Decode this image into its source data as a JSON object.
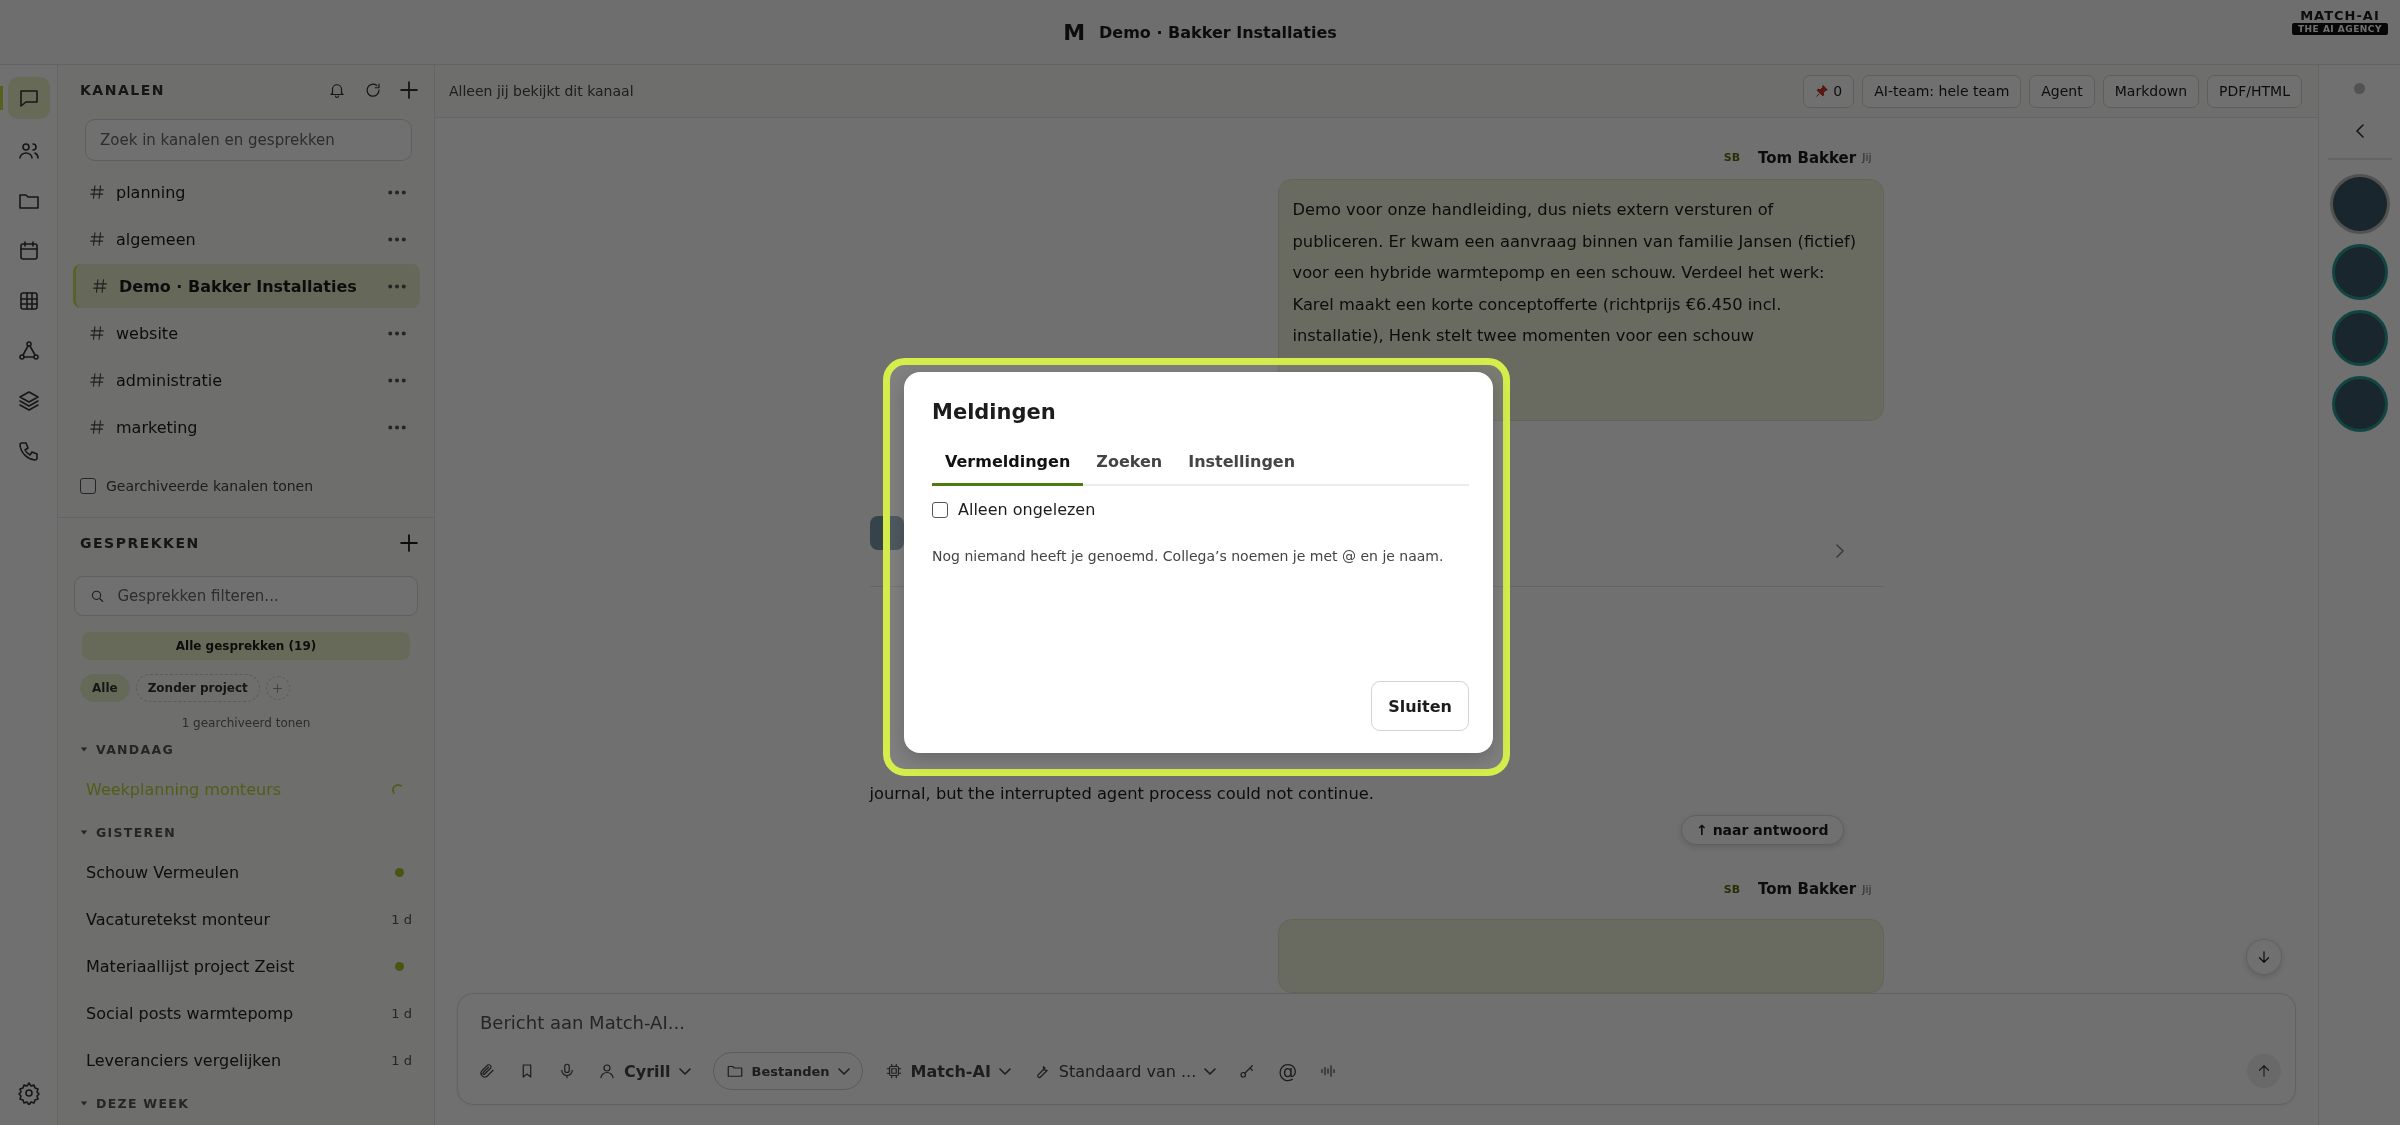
{
  "window": {
    "logo_letter": "M",
    "title": "Demo · Bakker Installaties",
    "brand": {
      "name": "MATCH-AI",
      "tagline": "THE AI AGENCY"
    }
  },
  "rail": {
    "items": [
      {
        "kind": "chat",
        "selected": true
      },
      {
        "kind": "people",
        "selected": false
      },
      {
        "kind": "folder",
        "selected": false
      },
      {
        "kind": "calendar",
        "selected": false
      },
      {
        "kind": "table",
        "selected": false
      },
      {
        "kind": "network",
        "selected": false
      },
      {
        "kind": "layers",
        "selected": false
      },
      {
        "kind": "phone",
        "selected": false
      }
    ]
  },
  "sidebar": {
    "channels_title": "KANALEN",
    "search": {
      "placeholder": "Zoek in kanalen en gesprekken"
    },
    "channels": [
      {
        "name": "planning",
        "selected": false
      },
      {
        "name": "algemeen",
        "selected": false
      },
      {
        "name": "Demo · Bakker Installaties",
        "selected": true
      },
      {
        "name": "website",
        "selected": false
      },
      {
        "name": "administratie",
        "selected": false
      },
      {
        "name": "marketing",
        "selected": false
      }
    ],
    "archived_toggle": {
      "label": "Gearchiveerde kanalen tonen",
      "checked": false
    },
    "conversations_title": "GESPREKKEN",
    "filter": {
      "placeholder": "Gesprekken filteren..."
    },
    "all_button": "Alle gesprekken (19)",
    "chips": [
      {
        "label": "Alle",
        "selected": true
      },
      {
        "label": "Zonder project",
        "selected": false
      }
    ],
    "archived_link": "1 gearchiveerd tonen",
    "groups": [
      {
        "title": "VANDAAG",
        "expanded": true,
        "items": [
          {
            "name": "Weekplanning monteurs",
            "selected": true,
            "kind": "spinner"
          }
        ]
      },
      {
        "title": "GISTEREN",
        "expanded": true,
        "items": [
          {
            "name": "Schouw Vermeulen",
            "selected": false,
            "kind": "dot"
          },
          {
            "name": "Vacaturetekst monteur",
            "selected": false,
            "kind": "age",
            "age": "1 d"
          },
          {
            "name": "Materiaallijst project Zeist",
            "selected": false,
            "kind": "dot"
          },
          {
            "name": "Social posts warmtepomp",
            "selected": false,
            "kind": "age",
            "age": "1 d"
          },
          {
            "name": "Leveranciers vergelijken",
            "selected": false,
            "kind": "age",
            "age": "1 d"
          }
        ]
      },
      {
        "title": "DEZE WEEK",
        "expanded": true
      }
    ]
  },
  "channel_bar": {
    "notice": "Alleen jij bekijkt dit kanaal",
    "pins": "0",
    "buttons": [
      "AI-team: hele team",
      "Agent",
      "Markdown",
      "PDF/HTML"
    ]
  },
  "messages": [
    {
      "kind": "user",
      "initials": "SB",
      "author": "Tom Bakker",
      "tag": "Jij",
      "text": "Demo voor onze handleiding, dus niets extern versturen of publiceren. Er kwam een aanvraag binnen van familie Jansen (fictief) voor een hybride warmtepomp en een schouw. Verdeel het werk: Karel maakt een korte conceptofferte (richtprijs €6.450 incl. installatie), Henk stelt twee momenten voor een schouw"
    },
    {
      "kind": "agent",
      "text": "journal, but the interrupted agent process could not continue.",
      "jump": "↑ naar antwoord"
    },
    {
      "kind": "user",
      "initials": "SB",
      "author": "Tom Bakker",
      "tag": "Jij"
    }
  ],
  "composer": {
    "placeholder": "Bericht aan Match-AI...",
    "user": "Cyrill",
    "files": "Bestanden",
    "model": "Match-AI",
    "preset": "Standaard van ...",
    "mention": "@"
  },
  "right_rail": {
    "avatars": [
      {
        "selected": true
      },
      {
        "selected": false
      },
      {
        "selected": false
      },
      {
        "selected": false
      }
    ]
  },
  "dialog": {
    "title": "Meldingen",
    "tabs": [
      {
        "label": "Vermeldingen",
        "selected": true
      },
      {
        "label": "Zoeken",
        "selected": false
      },
      {
        "label": "Instellingen",
        "selected": false
      }
    ],
    "unread_only": {
      "label": "Alleen ongelezen",
      "checked": false
    },
    "empty_text": "Nog niemand heeft je genoemd. Collega’s noemen je met @ en je naam.",
    "close_button": "Sluiten"
  }
}
